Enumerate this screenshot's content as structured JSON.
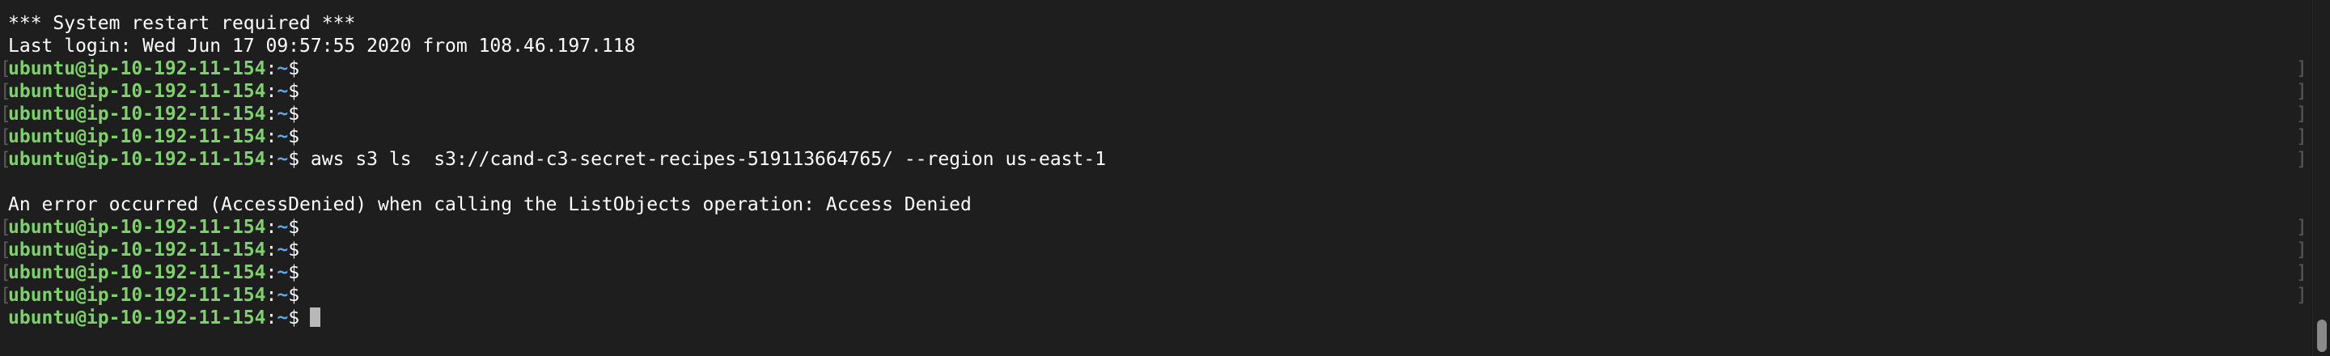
{
  "terminal": {
    "prompt_user_host": "ubuntu@ip-10-192-11-154",
    "prompt_colon": ":",
    "prompt_path": "~",
    "prompt_symbol": "$",
    "bracket_left": "[",
    "bracket_right": "]",
    "header_line1": "*** System restart required ***",
    "header_line2": "Last login: Wed Jun 17 09:57:55 2020 from 108.46.197.118",
    "command": " aws s3 ls  s3://cand-c3-secret-recipes-519113664765/ --region us-east-1",
    "error_line": "An error occurred (AccessDenied) when calling the ListObjects operation: Access Denied"
  }
}
